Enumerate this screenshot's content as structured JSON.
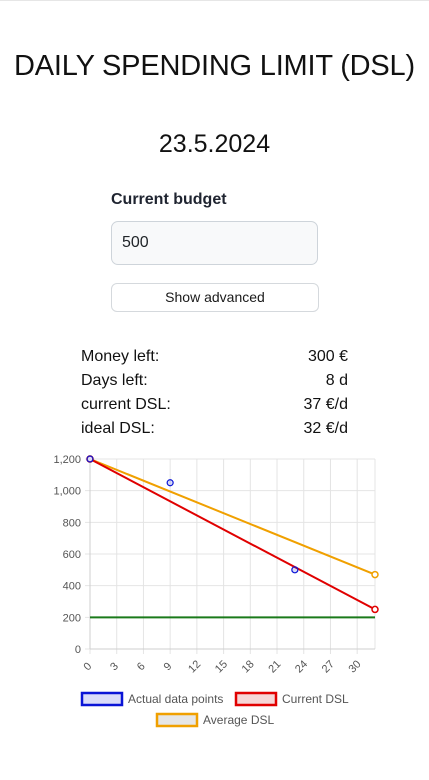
{
  "page": {
    "title": "DAILY SPENDING LIMIT (DSL)",
    "date": "23.5.2024"
  },
  "budget": {
    "label": "Current budget",
    "value": "500",
    "advanced_button": "Show advanced"
  },
  "stats": [
    {
      "label": "Money left:",
      "value": "300 €"
    },
    {
      "label": "Days left:",
      "value": "8 d"
    },
    {
      "label": "current DSL:",
      "value": "37 €/d"
    },
    {
      "label": "ideal DSL:",
      "value": "32 €/d"
    }
  ],
  "chart_data": {
    "type": "line",
    "x_ticks": [
      "0",
      "3",
      "6",
      "9",
      "12",
      "15",
      "18",
      "21",
      "24",
      "27",
      "30"
    ],
    "y_ticks": [
      "0",
      "200",
      "400",
      "600",
      "800",
      "1,000",
      "1,200"
    ],
    "xlim": [
      0,
      32
    ],
    "ylim": [
      0,
      1200
    ],
    "grid": true,
    "legend_position": "bottom",
    "series": [
      {
        "name": "Actual data points",
        "type": "scatter",
        "color": "#0a14d6",
        "points": [
          [
            0,
            1200
          ],
          [
            9,
            1050
          ],
          [
            23,
            500
          ]
        ]
      },
      {
        "name": "Current DSL",
        "type": "line",
        "color": "#e00000",
        "points": [
          [
            0,
            1200
          ],
          [
            32,
            250
          ]
        ]
      },
      {
        "name": "Average DSL",
        "type": "line",
        "color": "#f0a000",
        "points": [
          [
            0,
            1200
          ],
          [
            32,
            470
          ]
        ]
      },
      {
        "name": "",
        "type": "line",
        "color": "#1a7a1a",
        "points": [
          [
            0,
            200
          ],
          [
            32,
            200
          ]
        ]
      }
    ]
  }
}
